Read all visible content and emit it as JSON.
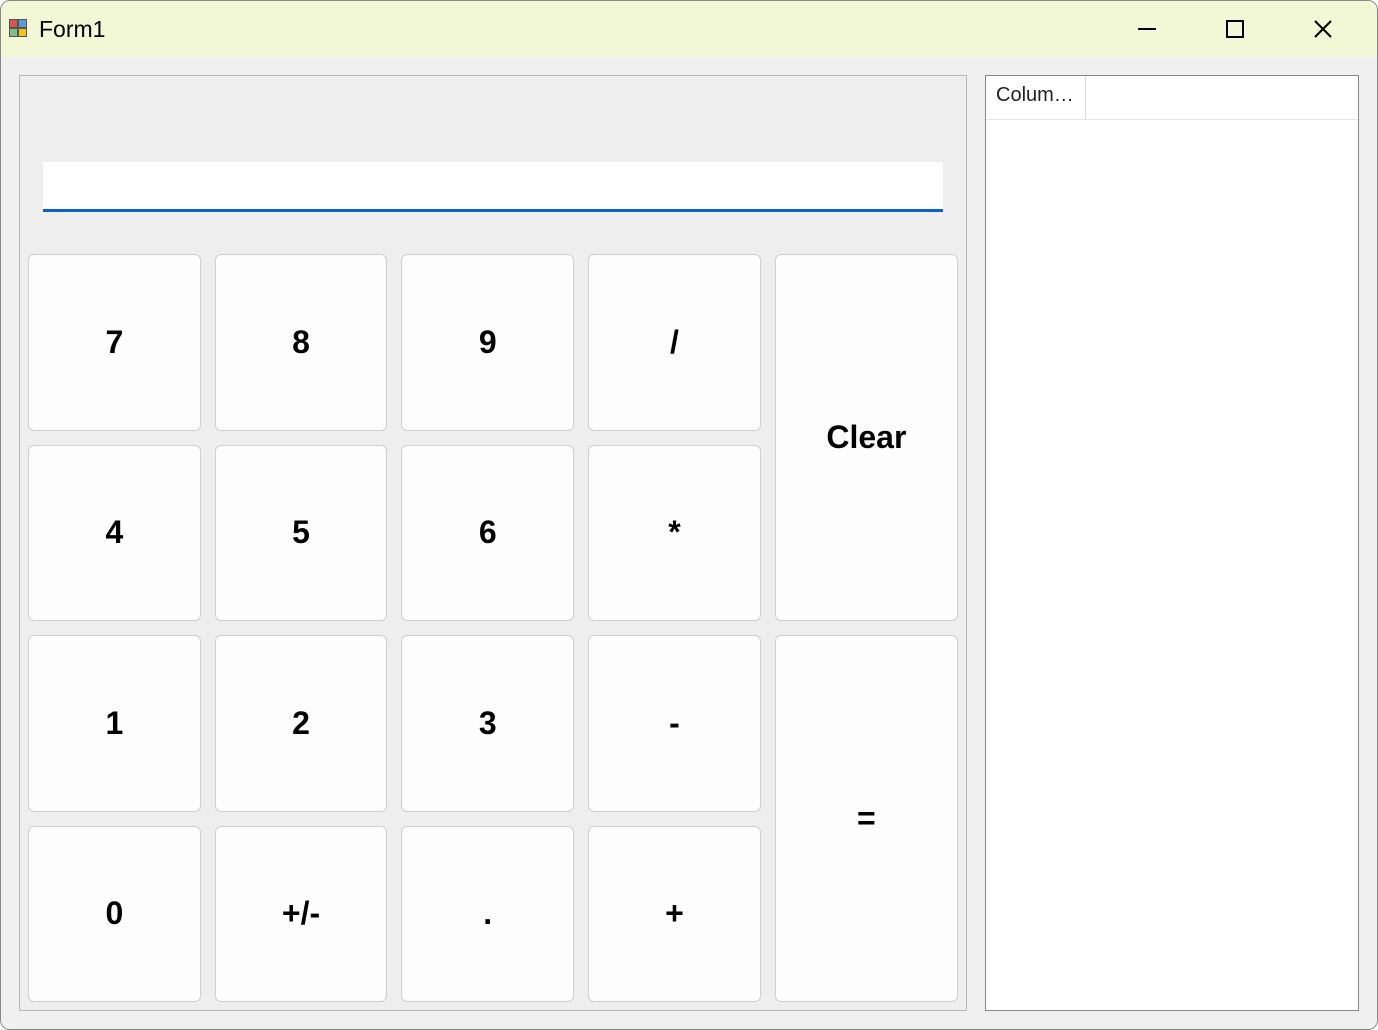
{
  "window": {
    "title": "Form1"
  },
  "display": {
    "value": ""
  },
  "buttons": {
    "row0": [
      "7",
      "8",
      "9",
      "/"
    ],
    "row1": [
      "4",
      "5",
      "6",
      "*"
    ],
    "row2": [
      "1",
      "2",
      "3",
      "-"
    ],
    "row3": [
      "0",
      "+/-",
      ".",
      "+"
    ],
    "clear": "Clear",
    "equals": "="
  },
  "list": {
    "column_header": "Column..."
  }
}
